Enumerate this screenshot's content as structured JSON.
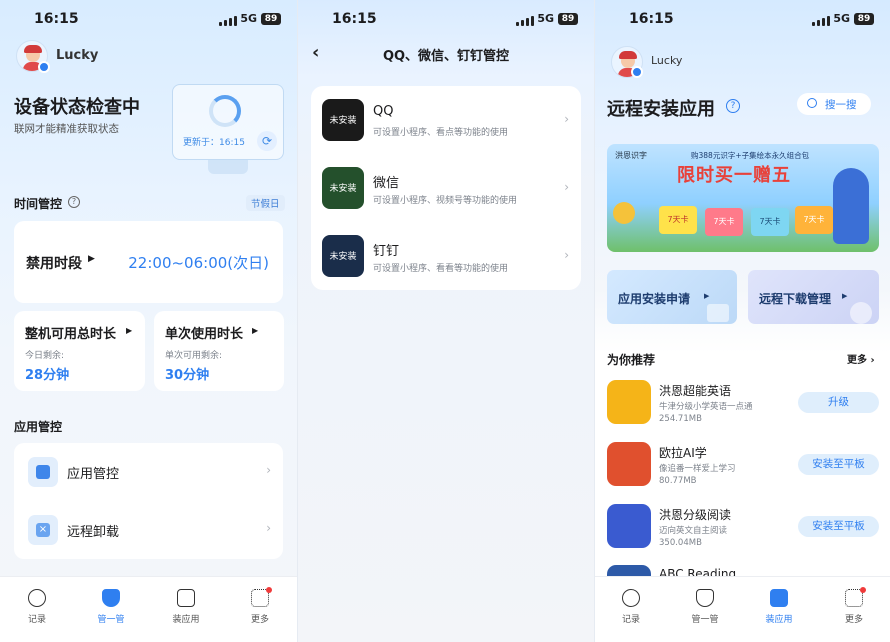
{
  "status_bar": {
    "time": "16:15",
    "network": "5G",
    "battery": "89"
  },
  "panel1": {
    "user_name": "Lucky",
    "device_status_title": "设备状态检查中",
    "device_status_subtitle": "联网才能精准获取状态",
    "updated_at": "更新于：16:15",
    "time_control": {
      "section_title": "时间管控",
      "holiday_label": "节假日",
      "disabled_period_label": "禁用时段",
      "disabled_period_value": "22:00~06:00(次日)",
      "total_label": "整机可用总时长",
      "total_sub": "今日剩余:",
      "total_value": "28分钟",
      "single_label": "单次使用时长",
      "single_sub": "单次可用剩余:",
      "single_value": "30分钟"
    },
    "app_control": {
      "section_title": "应用管控",
      "items": [
        {
          "label": "应用管控",
          "icon": "apps-icon"
        },
        {
          "label": "远程卸载",
          "icon": "uninstall-icon"
        }
      ]
    }
  },
  "panel2": {
    "title": "QQ、微信、钉钉管控",
    "not_installed": "未安装",
    "apps": [
      {
        "name": "QQ",
        "desc": "可设置小程序、看点等功能的使用",
        "color": "#1a1a1a"
      },
      {
        "name": "微信",
        "desc": "可设置小程序、视频号等功能的使用",
        "color": "#24502c"
      },
      {
        "name": "钉钉",
        "desc": "可设置小程序、看看等功能的使用",
        "color": "#1a2d4a"
      }
    ]
  },
  "panel3": {
    "user_name": "Lucky",
    "title": "远程安装应用",
    "search_label": "搜一搜",
    "banner": {
      "brand": "洪恩识字",
      "top_line": "购388元识字+子集绘本永久组合包",
      "headline": "限时买一赠五",
      "card_text": "7天卡"
    },
    "apply_install": "应用安装申请",
    "remote_download": "远程下载管理",
    "recommend_title": "为你推荐",
    "more_label": "更多",
    "apps": [
      {
        "name": "洪恩超能英语",
        "desc": "牛津分级小学英语一点通",
        "size": "254.71MB",
        "action": "升级",
        "icon_color": "#f5b418"
      },
      {
        "name": "欧拉AI学",
        "desc": "像追番一样爱上学习",
        "size": "80.77MB",
        "action": "安装至平板",
        "icon_color": "#e0502e"
      },
      {
        "name": "洪恩分级阅读",
        "desc": "迈向英文自主阅读",
        "size": "350.04MB",
        "action": "安装至平板",
        "icon_color": "#3a5bd0"
      },
      {
        "name": "ABC Reading",
        "desc": "",
        "size": "",
        "action": "",
        "icon_color": "#2d5aa8"
      }
    ]
  },
  "tabs": [
    {
      "label": "记录",
      "icon": "clock-icon"
    },
    {
      "label": "管一管",
      "icon": "shield-icon"
    },
    {
      "label": "装应用",
      "icon": "bag-icon"
    },
    {
      "label": "更多",
      "icon": "grid-icon"
    }
  ],
  "colors": {
    "accent": "#2f7ff0",
    "badge_red": "#f03a3a"
  }
}
